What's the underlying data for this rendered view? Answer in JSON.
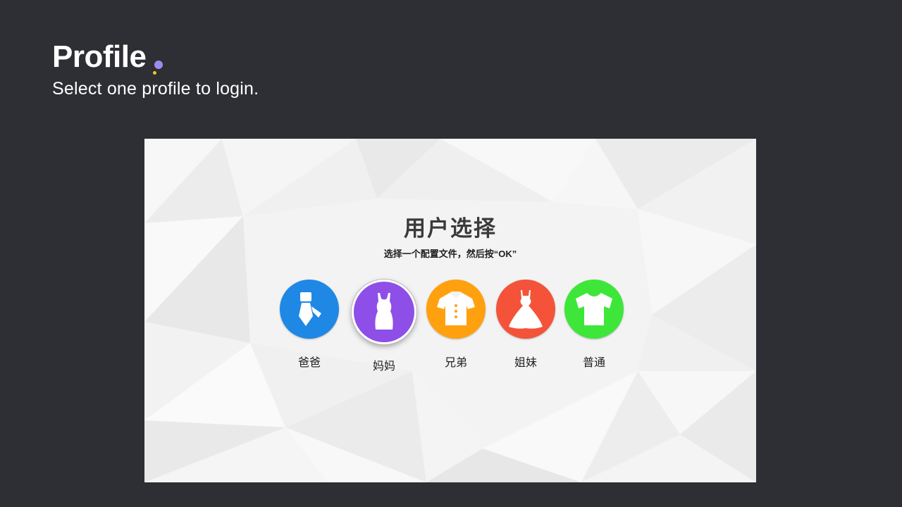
{
  "header": {
    "title": "Profile",
    "subtitle": "Select one profile to login."
  },
  "colors": {
    "page_background": "#2e2f34",
    "accent_dot_purple": "#9b8cf0",
    "accent_dot_yellow": "#f5c518",
    "panel_background": "#f3f3f3"
  },
  "panel": {
    "title": "用户选择",
    "subtitle": "选择一个配置文件，然后按“OK”"
  },
  "profiles": [
    {
      "label": "爸爸",
      "icon": "necktie-icon",
      "color": "#1f88e5",
      "selected": false
    },
    {
      "label": "妈妈",
      "icon": "dress-icon",
      "color": "#8e4ee8",
      "selected": true
    },
    {
      "label": "兄弟",
      "icon": "shirt-icon",
      "color": "#ffa10f",
      "selected": false
    },
    {
      "label": "姐妹",
      "icon": "gown-icon",
      "color": "#f4533a",
      "selected": false
    },
    {
      "label": "普通",
      "icon": "tshirt-icon",
      "color": "#3ee63a",
      "selected": false
    }
  ]
}
